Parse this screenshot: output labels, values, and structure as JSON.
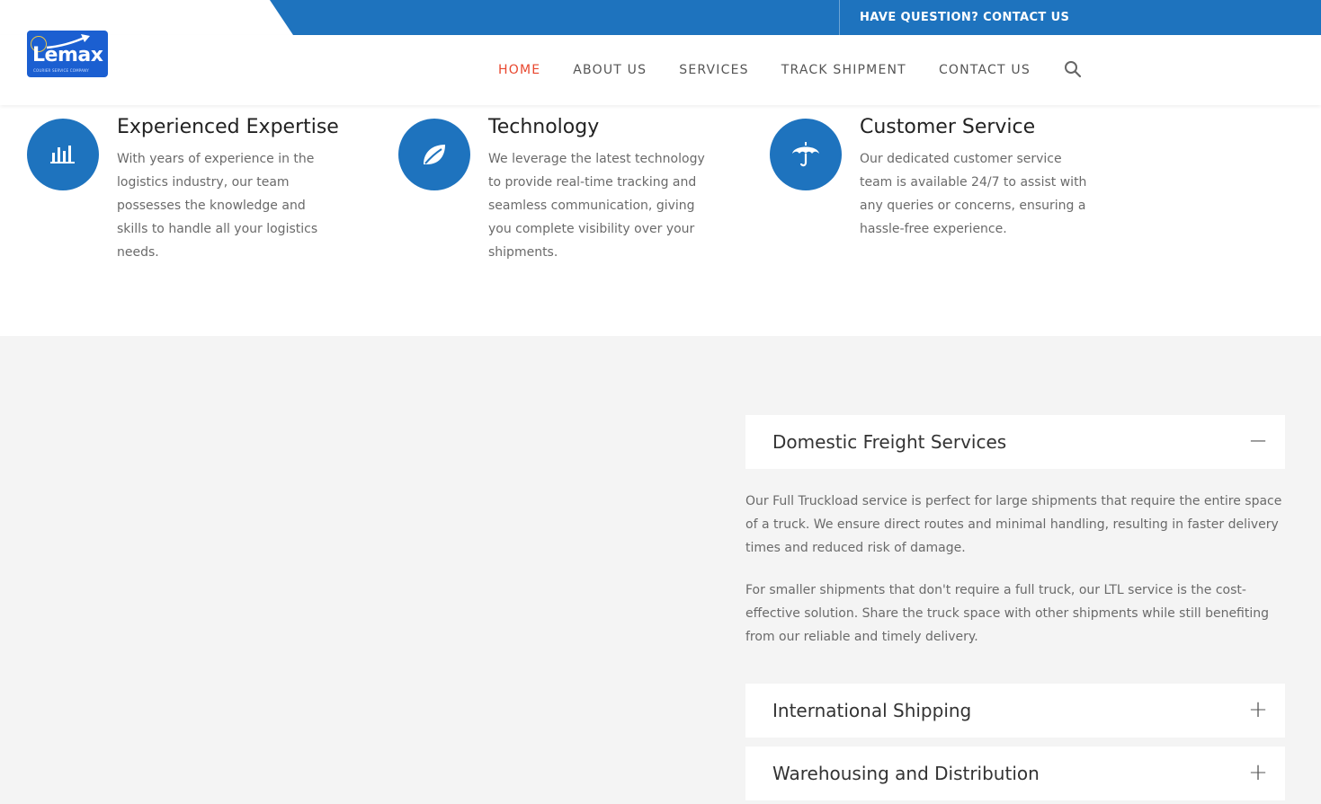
{
  "topbar": {
    "contact_label": "HAVE QUESTION? CONTACT US"
  },
  "brand": {
    "name": "Lemax",
    "tagline": "COURIER SERVICE COMPANY"
  },
  "nav": [
    {
      "label": "HOME",
      "active": true
    },
    {
      "label": "ABOUT US"
    },
    {
      "label": "SERVICES"
    },
    {
      "label": "TRACK SHIPMENT"
    },
    {
      "label": "CONTACT US"
    }
  ],
  "features": [
    {
      "icon": "bar-chart-icon",
      "title": "Experienced Expertise",
      "text": "With years of experience in the logistics industry, our team possesses the knowledge and skills to handle all your logistics needs."
    },
    {
      "icon": "leaf-icon",
      "title": "Technology",
      "text": "We leverage the latest technology to provide real-time tracking and seamless communication, giving you complete visibility over your shipments."
    },
    {
      "icon": "umbrella-icon",
      "title": "Customer Service",
      "text": "Our dedicated customer service team is available 24/7 to assist with any queries or concerns, ensuring a hassle-free experience."
    }
  ],
  "accordion": [
    {
      "title": "Domestic Freight Services",
      "toggle": "−",
      "expanded": true,
      "paragraphs": [
        "Our Full Truckload service is perfect for large shipments that require the entire space of a truck. We ensure direct routes and minimal handling, resulting in faster delivery times and reduced risk of damage.",
        "For smaller shipments that don't require a full truck, our LTL service is the cost-effective solution. Share the truck space with other shipments while still benefiting from our reliable and timely delivery."
      ]
    },
    {
      "title": "International Shipping",
      "toggle": "+",
      "expanded": false
    },
    {
      "title": "Warehousing and Distribution",
      "toggle": "+",
      "expanded": false
    }
  ],
  "colors": {
    "primary": "#1e73be",
    "active_nav": "#e8472e",
    "section_bg": "#f4f4f4"
  }
}
